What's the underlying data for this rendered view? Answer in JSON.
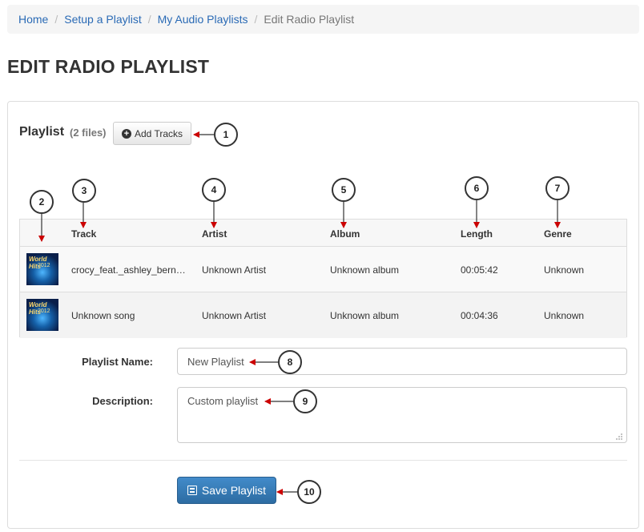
{
  "breadcrumb": [
    "Home",
    "Setup a Playlist",
    "My Audio Playlists",
    "Edit Radio Playlist"
  ],
  "page_title": "EDIT RADIO PLAYLIST",
  "playlist": {
    "heading": "Playlist",
    "file_count": "(2 files)",
    "add_tracks_label": "Add Tracks"
  },
  "table": {
    "columns": [
      "Track",
      "Artist",
      "Album",
      "Length",
      "Genre"
    ],
    "rows": [
      {
        "track": "crocy_feat._ashley_bern…",
        "artist": "Unknown Artist",
        "album": "Unknown album",
        "length": "00:05:42",
        "genre": "Unknown",
        "thumb_text": [
          "World Hits",
          "2012"
        ]
      },
      {
        "track": "Unknown song",
        "artist": "Unknown Artist",
        "album": "Unknown album",
        "length": "00:04:36",
        "genre": "Unknown",
        "thumb_text": [
          "World Hits",
          "2012"
        ]
      }
    ]
  },
  "form": {
    "name_label": "Playlist Name:",
    "name_value": "New Playlist",
    "description_label": "Description:",
    "description_value": "Custom playlist",
    "save_label": "Save Playlist"
  },
  "callouts": [
    "1",
    "2",
    "3",
    "4",
    "5",
    "6",
    "7",
    "8",
    "9",
    "10"
  ],
  "colors": {
    "link": "#2a6ab5",
    "primary_button": "#428bca",
    "arrow": "#cc0000"
  }
}
